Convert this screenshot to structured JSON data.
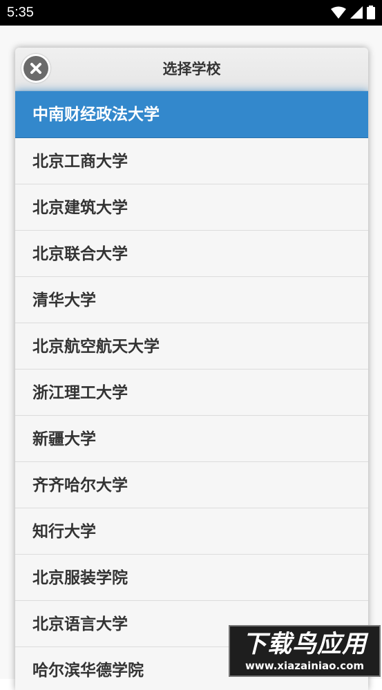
{
  "status_bar": {
    "time": "5:35",
    "icons": [
      "wifi-icon",
      "signal-icon",
      "battery-icon"
    ]
  },
  "dialog": {
    "title": "选择学校",
    "close_icon": "close-icon",
    "selected_index": 0,
    "items": [
      {
        "label": "中南财经政法大学"
      },
      {
        "label": "北京工商大学"
      },
      {
        "label": "北京建筑大学"
      },
      {
        "label": "北京联合大学"
      },
      {
        "label": "清华大学"
      },
      {
        "label": "北京航空航天大学"
      },
      {
        "label": "浙江理工大学"
      },
      {
        "label": "新疆大学"
      },
      {
        "label": "齐齐哈尔大学"
      },
      {
        "label": "知行大学"
      },
      {
        "label": "北京服装学院"
      },
      {
        "label": "北京语言大学"
      },
      {
        "label": "哈尔滨华德学院"
      }
    ]
  },
  "watermark": {
    "brand": "下载鸟应用",
    "url": "www.xiazainiao.com"
  },
  "colors": {
    "selected_bg": "#3388cc",
    "selected_text": "#ffffff",
    "item_text": "#333333",
    "list_bg": "#f6f6f6"
  }
}
